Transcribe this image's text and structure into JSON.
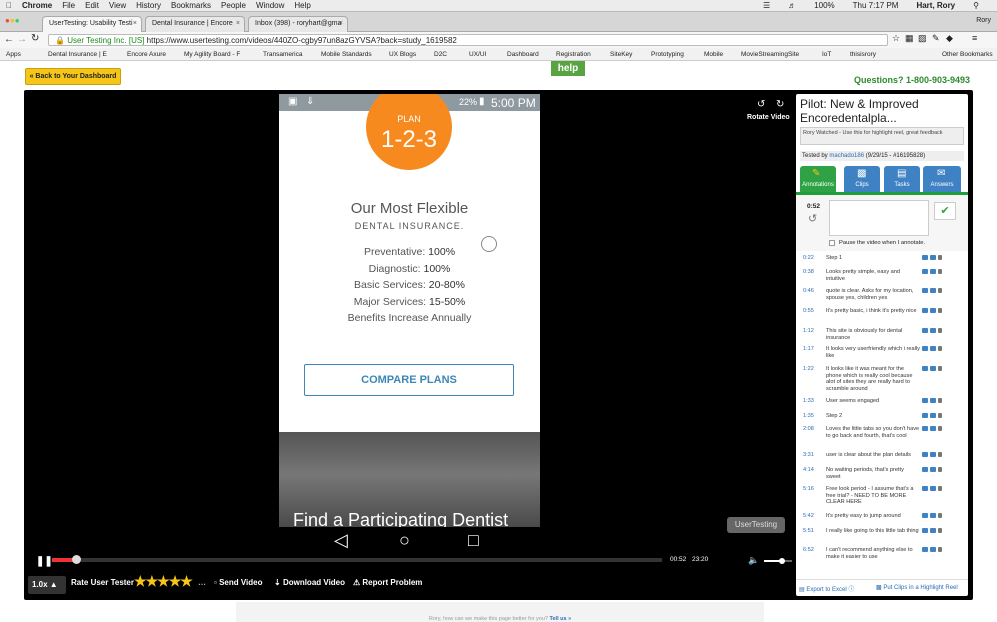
{
  "os_menubar": {
    "app": "Chrome",
    "menus": [
      "File",
      "Edit",
      "View",
      "History",
      "Bookmarks",
      "People",
      "Window",
      "Help"
    ],
    "battery": "100%",
    "clock": "Thu 7:17 PM",
    "user": "Hart, Rory"
  },
  "tabs": [
    {
      "label": "UserTesting: Usability Testi"
    },
    {
      "label": "Dental Insurance | Encore"
    },
    {
      "label": "Inbox (398) - roryhart@gma"
    }
  ],
  "profile_name": "Rory",
  "address": {
    "secure_label": "User Testing Inc. [US]",
    "url": "https://www.usertesting.com/videos/440ZO-cgby97un8azGYVSA?back=study_1619582"
  },
  "bookmarks": [
    "Apps",
    "Dental Insurance | E",
    "Encore Axure",
    "My Agility Board - F",
    "Transamerica",
    "Mobile Standards",
    "UX Blogs",
    "D2C",
    "UX/UI",
    "Dashboard",
    "Registration",
    "SiteKey",
    "Prototyping",
    "Mobile",
    "MovieStreamingSite",
    "IoT",
    "thisisrory",
    "Other Bookmarks"
  ],
  "header": {
    "back_label": "« Back to Your Dashboard",
    "help_label": "help",
    "phone": "Questions? 1-800-903-9493"
  },
  "player": {
    "rotate_label": "Rotate Video",
    "time_current": "00:52",
    "time_total": "23:20",
    "progress": 0.04,
    "volume": 0.65,
    "watermark": "UserTesting",
    "speed": "1.0x",
    "rate_label": "Rate User Tester",
    "rating": 5,
    "send_label": "Send Video",
    "download_label": "Download Video",
    "report_label": "Report Problem"
  },
  "device": {
    "battery": "22%",
    "time": "5:00 PM",
    "plan_label": "PLAN",
    "plan_number": "1-2-3",
    "headline": "Our Most Flexible",
    "subhead": "DENTAL INSURANCE.",
    "coverage": [
      {
        "name": "Preventative:",
        "value": "100%"
      },
      {
        "name": "Diagnostic:",
        "value": "100%"
      },
      {
        "name": "Basic Services:",
        "value": "20-80%"
      },
      {
        "name": "Major Services:",
        "value": "15-50%"
      }
    ],
    "benefits_line": "Benefits Increase Annually",
    "compare_label": "COMPARE PLANS",
    "find_dentist": "Find a Participating Dentist"
  },
  "sidebar": {
    "title": "Pilot: New & Improved Encoredentalpla...",
    "note": "Rory Watched - Use this for highlight reel, great feedback",
    "tested_by_prefix": "Tested by",
    "tester": "machado186",
    "tested_meta": "(9/29/15 - #16195828)",
    "tabs": [
      "Annotations",
      "Clips",
      "Tasks",
      "Answers"
    ],
    "current_time": "0:52",
    "pause_label": "Pause the video when I annotate.",
    "annotations": [
      {
        "time": "0:22",
        "text": "Step 1"
      },
      {
        "time": "0:38",
        "text": "Looks pretty simple, easy and intuitive"
      },
      {
        "time": "0:46",
        "text": "quote is clear. Asks for my location, spouse yes, children yes"
      },
      {
        "time": "0:55",
        "text": "It's pretty basic, i think it's pretty nice"
      },
      {
        "time": "1:12",
        "text": "This site is obviously for dental insurance"
      },
      {
        "time": "1:17",
        "text": "It looks very userfriendly which i really like"
      },
      {
        "time": "1:22",
        "text": "It looks like it was meant for the phone which is really cool because alot of sites they are really hard to scramble around"
      },
      {
        "time": "1:33",
        "text": "User seems engaged"
      },
      {
        "time": "1:35",
        "text": "Step 2"
      },
      {
        "time": "2:08",
        "text": "Loves the little tabs so you don't have to go back and fourth, that's cool"
      },
      {
        "time": "3:31",
        "text": "user is clear about the plan details"
      },
      {
        "time": "4:14",
        "text": "No waiting periods, that's pretty sweet"
      },
      {
        "time": "5:16",
        "text": "Free look period - I assume that's a free trial? - NEED TO BE MORE CLEAR HERE"
      },
      {
        "time": "5:42",
        "text": "It's pretty easy to jump around"
      },
      {
        "time": "5:51",
        "text": "I really like going to this little tab thing"
      },
      {
        "time": "6:52",
        "text": "I can't recommend anything else to make it easier to use"
      }
    ],
    "export_label": "Export to Excel",
    "highlight_label": "Put Clips in a Highlight Reel"
  },
  "footer": {
    "text": "Rory, how can we make this page better for you?",
    "link": "Tell us »"
  },
  "colors": {
    "accent_green": "#58a342",
    "plan_orange": "#f78a1f",
    "link_blue": "#2a6db3",
    "back_yellow": "#f5c518"
  }
}
